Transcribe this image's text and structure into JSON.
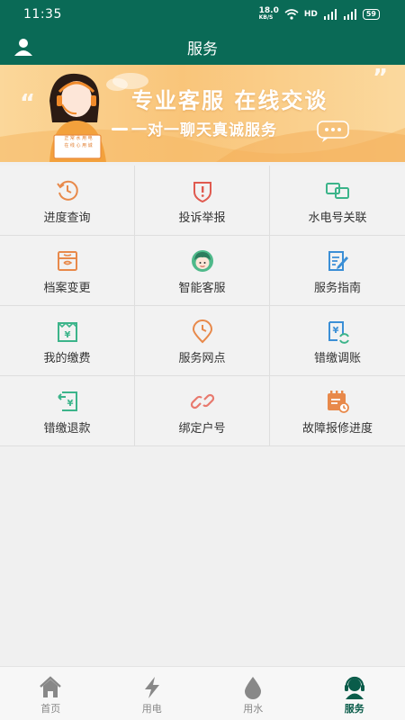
{
  "status_bar": {
    "time": "11:35",
    "net_speed_top": "18.0",
    "net_speed_unit": "KB/S",
    "hd_label": "HD",
    "battery": "59"
  },
  "app_bar": {
    "title": "服务",
    "user_icon": "user-icon"
  },
  "banner": {
    "headline": "专业客服 在线交谈",
    "subline": "一对一聊天真诚服务",
    "sign_line1": "正 常 水 用 电",
    "sign_line2": "在 线 心 用 诚",
    "colors": {
      "start": "#fbd79a",
      "end": "#f9c57a"
    }
  },
  "services": [
    {
      "label": "进度查询",
      "icon": "clock-history-icon",
      "color": "#e8894a"
    },
    {
      "label": "投诉举报",
      "icon": "shield-alert-icon",
      "color": "#e05a4f"
    },
    {
      "label": "水电号关联",
      "icon": "link-cards-icon",
      "color": "#3cb48a"
    },
    {
      "label": "档案变更",
      "icon": "archive-box-icon",
      "color": "#e8894a"
    },
    {
      "label": "智能客服",
      "icon": "agent-avatar-icon",
      "color": "#3cb48a"
    },
    {
      "label": "服务指南",
      "icon": "guide-document-icon",
      "color": "#3b8fd6"
    },
    {
      "label": "我的缴费",
      "icon": "payment-icon",
      "color": "#3cb48a"
    },
    {
      "label": "服务网点",
      "icon": "location-clock-icon",
      "color": "#e8894a"
    },
    {
      "label": "错缴调账",
      "icon": "refresh-payment-icon",
      "color": "#3b8fd6"
    },
    {
      "label": "错缴退款",
      "icon": "refund-icon",
      "color": "#3cb48a"
    },
    {
      "label": "绑定户号",
      "icon": "chain-link-icon",
      "color": "#e8796e"
    },
    {
      "label": "故障报修进度",
      "icon": "repair-calendar-icon",
      "color": "#e8894a"
    }
  ],
  "tabs": [
    {
      "label": "首页",
      "icon": "home-icon",
      "active": false
    },
    {
      "label": "用电",
      "icon": "lightning-icon",
      "active": false
    },
    {
      "label": "用水",
      "icon": "water-drop-icon",
      "active": false
    },
    {
      "label": "服务",
      "icon": "service-agent-icon",
      "active": true
    }
  ],
  "colors": {
    "primary": "#0a6a56",
    "tab_active": "#0a5c4a",
    "tab_inactive": "#888888"
  }
}
